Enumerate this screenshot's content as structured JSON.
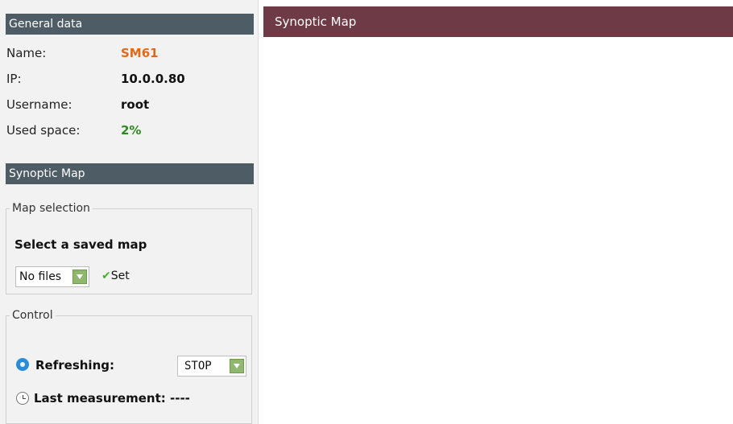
{
  "general": {
    "header": "General data",
    "rows": [
      {
        "label": "Name:",
        "value": "SM61"
      },
      {
        "label": "IP:",
        "value": "10.0.0.80"
      },
      {
        "label": "Username:",
        "value": "root"
      },
      {
        "label": "Used space:",
        "value": "2%"
      }
    ],
    "colors": {
      "name_value": "#e06a1b",
      "used_space_value": "#2e8b1f"
    }
  },
  "synoptic": {
    "header": "Synoptic Map",
    "map_selection": {
      "legend": "Map selection",
      "title": "Select a saved map",
      "select_value": "No files",
      "set_label": "Set",
      "set_icon": "check-icon"
    },
    "control": {
      "legend": "Control",
      "refreshing_label": "Refreshing:",
      "refreshing_icon": "refresh-icon",
      "refreshing_value": "STOP",
      "last_measurement_label": "Last measurement:",
      "last_measurement_icon": "clock-icon",
      "last_measurement_value": "----"
    }
  },
  "main": {
    "header": "Synoptic Map",
    "header_color": "#6e3a46"
  }
}
